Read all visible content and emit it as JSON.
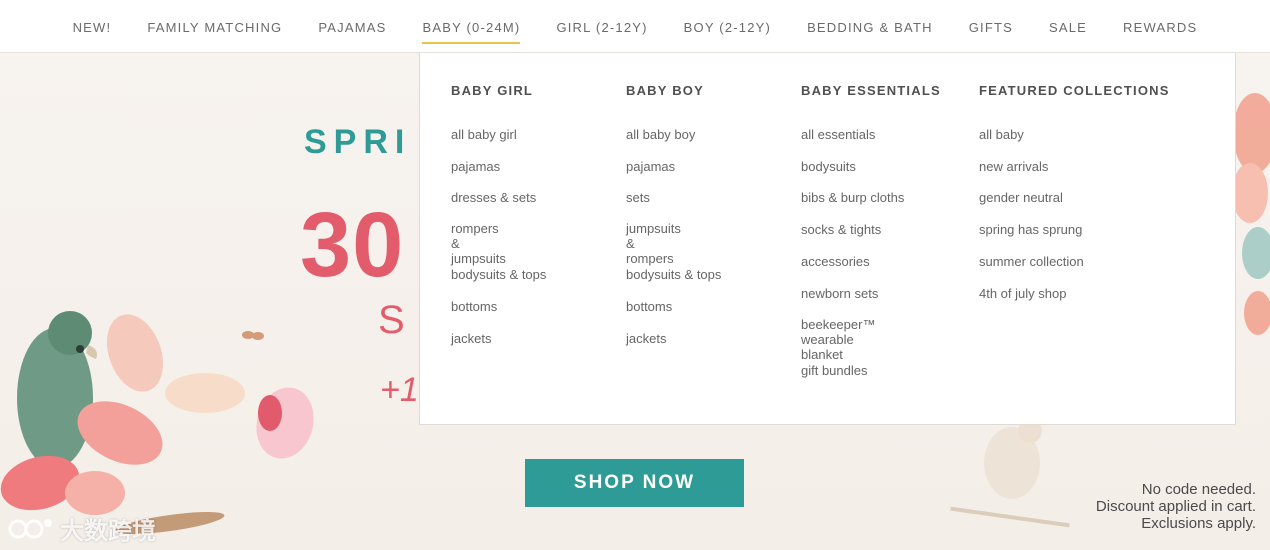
{
  "nav": {
    "items": [
      {
        "label": "NEW!"
      },
      {
        "label": "FAMILY MATCHING"
      },
      {
        "label": "PAJAMAS"
      },
      {
        "label": "BABY (0-24M)"
      },
      {
        "label": "GIRL (2-12Y)"
      },
      {
        "label": "BOY (2-12Y)"
      },
      {
        "label": "BEDDING & BATH"
      },
      {
        "label": "GIFTS"
      },
      {
        "label": "SALE"
      },
      {
        "label": "REWARDS"
      }
    ],
    "active": "BABY (0-24M)"
  },
  "hero": {
    "title_visible": "SPRI",
    "amount_visible": "30",
    "sub_visible": "S",
    "plus_visible": "+1",
    "cta": "SHOP NOW",
    "fine_print": [
      "No code needed.",
      "Discount applied in cart.",
      "Exclusions apply."
    ]
  },
  "dropdown": {
    "columns": [
      {
        "heading": "BABY GIRL",
        "links": [
          "all baby girl",
          "pajamas",
          "dresses & sets",
          "rompers &\njumpsuits",
          "bodysuits & tops",
          "bottoms",
          "jackets"
        ]
      },
      {
        "heading": "BABY BOY",
        "links": [
          "all baby boy",
          "pajamas",
          "sets",
          "jumpsuits &\nrompers",
          "bodysuits & tops",
          "bottoms",
          "jackets"
        ]
      },
      {
        "heading": "BABY ESSENTIALS",
        "links": [
          "all essentials",
          "bodysuits",
          "bibs & burp cloths",
          "socks & tights",
          "accessories",
          "newborn sets",
          "beekeeper™\nwearable blanket",
          "gift bundles"
        ]
      },
      {
        "heading": "FEATURED COLLECTIONS",
        "links": [
          "all baby",
          "new arrivals",
          "gender neutral",
          "spring has sprung",
          "summer collection",
          "4th of july shop"
        ]
      }
    ]
  },
  "watermark": "大数跨境",
  "colors": {
    "teal": "#2f9b97",
    "coral": "#e25c6c",
    "underline": "#e6c64a",
    "background": "#f7f3ef"
  }
}
